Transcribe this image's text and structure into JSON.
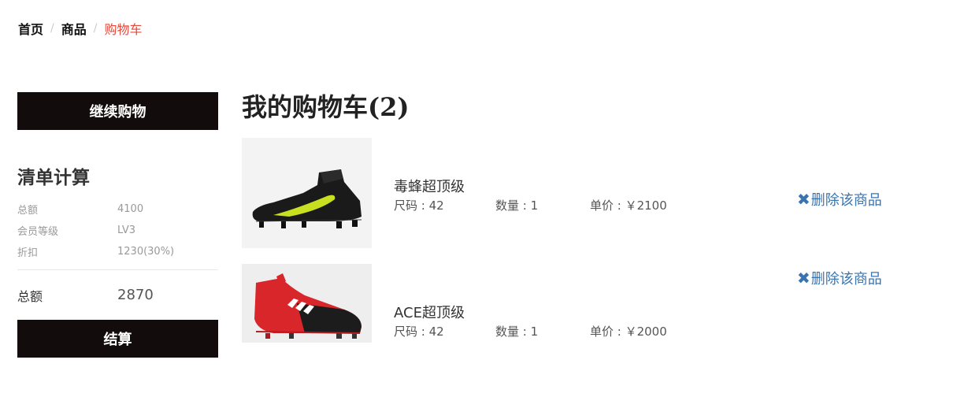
{
  "breadcrumb": {
    "home": "首页",
    "products": "商品",
    "current": "购物车",
    "separator": "/"
  },
  "sidebar": {
    "continue_label": "继续购物",
    "calc_title": "清单计算",
    "rows": [
      {
        "key": "总额",
        "value": "4100"
      },
      {
        "key": "会员等级",
        "value": "LV3"
      },
      {
        "key": "折扣",
        "value": "1230(30%)"
      }
    ],
    "total_key": "总额",
    "total_value": "2870",
    "checkout_label": "结算"
  },
  "cart": {
    "title": "我的购物车(2)",
    "delete_label": "删除该商品",
    "items": [
      {
        "name": "毒蜂超顶级",
        "size": "尺码 : 42",
        "qty": "数量 : 1",
        "price": "单价 : ￥2100"
      },
      {
        "name": "ACE超顶级",
        "size": "尺码 : 42",
        "qty": "数量 : 1",
        "price": "单价 : ￥2000"
      }
    ]
  },
  "colors": {
    "accent": "#e64a3b",
    "button_bg": "#120d0c",
    "link": "#3a74b0"
  }
}
